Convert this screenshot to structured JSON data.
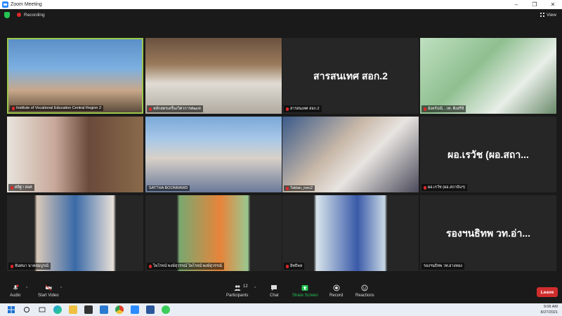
{
  "window": {
    "title": "Zoom Meeting"
  },
  "topbar": {
    "recording": "Recording",
    "view": "View"
  },
  "tiles": [
    {
      "name": "Institute of Vocational Education Central Region 2",
      "big": ""
    },
    {
      "name": "หลักสตรเครื่องวิศวการศฒเท",
      "big": ""
    },
    {
      "name": "สารสนเทศ สอก.2",
      "big": "สารสนเทศ สอก.2"
    },
    {
      "name": "อังคร์ปณิ ..วท. ติงสริจิ",
      "big": ""
    },
    {
      "name": "ศลิฐา สอศ",
      "big": ""
    },
    {
      "name": "SATTHA BOONRAWD",
      "big": ""
    },
    {
      "name": "Taktan_ivec2",
      "big": ""
    },
    {
      "name": "ผอ.เรวัช (ผอ.สถาบันฯ)",
      "big": "ผอ.เรวัช (ผอ.สถา..."
    },
    {
      "name": "จันทนา นาคสมบูรณ์",
      "big": ""
    },
    {
      "name": "ไพโรจน์ พงษ์สุวรรณ์ ไพโรจน์ พงษ์สุวรรณ์",
      "big": ""
    },
    {
      "name": "อิทธิพล",
      "big": ""
    },
    {
      "name": "รองฯนธิทพ วท.อ่างทอง",
      "big": "รองฯนธิทพ วท.อ่า..."
    }
  ],
  "toolbar": {
    "audio": "Audio",
    "video": "Start Video",
    "participants": "Participants",
    "participants_count": "12",
    "chat": "Chat",
    "share": "Share Screen",
    "record": "Record",
    "reactions": "Reactions",
    "leave": "Leave"
  },
  "taskbar": {
    "time": "9:06 AM",
    "date": "8/27/2021"
  },
  "colors": {
    "accent": "#23c552",
    "leave": "#d12d2d",
    "active_border": "#9ec94a"
  }
}
